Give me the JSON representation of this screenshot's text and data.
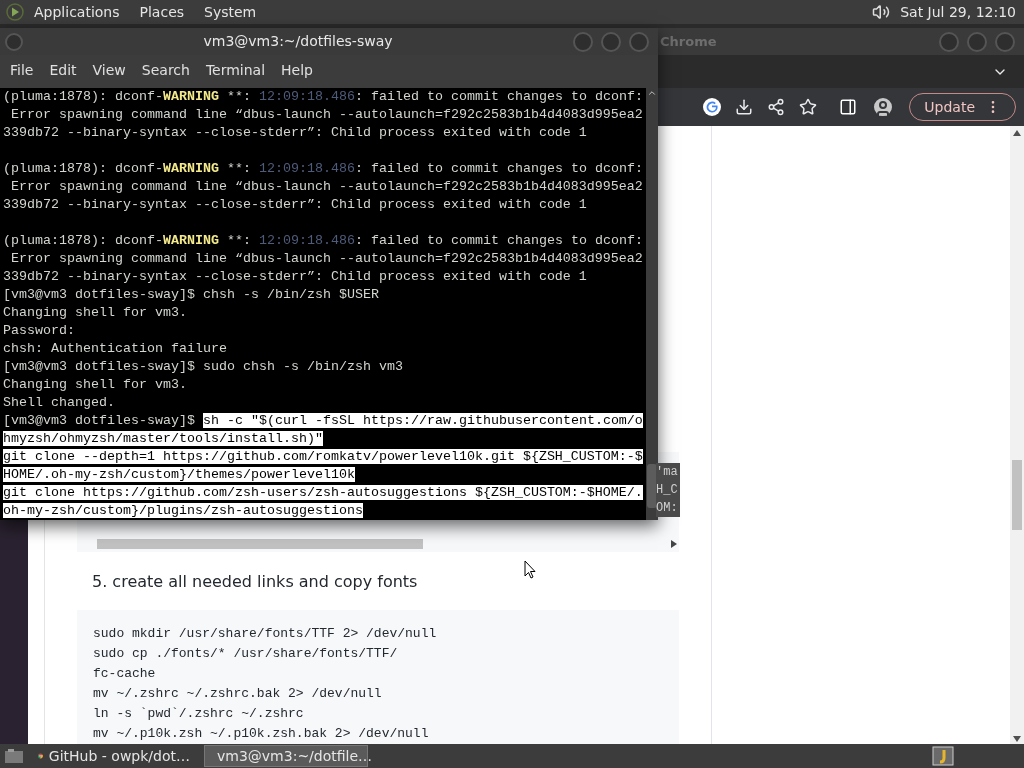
{
  "top_panel": {
    "menus": [
      "Applications",
      "Places",
      "System"
    ],
    "clock": "Sat Jul 29, 12:10"
  },
  "browser": {
    "title": "Chrome",
    "update_button": "Update",
    "page": {
      "heading": "5. create all needed links and copy fonts",
      "code_lines": [
        "sudo mkdir /usr/share/fonts/TTF 2> /dev/null",
        "sudo cp ./fonts/* /usr/share/fonts/TTF/",
        "fc-cache",
        "mv ~/.zshrc ~/.zshrc.bak 2> /dev/null",
        "ln -s `pwd`/.zshrc ~/.zshrc",
        "mv ~/.p10k.zsh ~/.p10k.zsh.bak 2> /dev/null"
      ]
    }
  },
  "terminal": {
    "title": "vm3@vm3:~/dotfiles-sway",
    "menu": [
      "File",
      "Edit",
      "View",
      "Search",
      "Terminal",
      "Help"
    ],
    "lines": [
      {
        "kind": "text",
        "segments": [
          {
            "kind": "plain",
            "text": "(pluma:1878): dconf-"
          },
          {
            "kind": "warning",
            "text": "WARNING"
          },
          {
            "kind": "plain",
            "text": " **: "
          },
          {
            "kind": "timestamp",
            "text": "12:09:18.486"
          },
          {
            "kind": "plain",
            "text": ": failed to commit changes to dconf:"
          }
        ]
      },
      {
        "kind": "text",
        "segments": [
          {
            "kind": "plain",
            "text": " Error spawning command line “dbus-launch --autolaunch=f292c2583b1b4d4083d995ea2"
          }
        ]
      },
      {
        "kind": "text",
        "segments": [
          {
            "kind": "plain",
            "text": "339db72 --binary-syntax --close-stderr”: Child process exited with code 1"
          }
        ]
      },
      {
        "kind": "blank"
      },
      {
        "kind": "text",
        "segments": [
          {
            "kind": "plain",
            "text": "(pluma:1878): dconf-"
          },
          {
            "kind": "warning",
            "text": "WARNING"
          },
          {
            "kind": "plain",
            "text": " **: "
          },
          {
            "kind": "timestamp",
            "text": "12:09:18.486"
          },
          {
            "kind": "plain",
            "text": ": failed to commit changes to dconf:"
          }
        ]
      },
      {
        "kind": "text",
        "segments": [
          {
            "kind": "plain",
            "text": " Error spawning command line “dbus-launch --autolaunch=f292c2583b1b4d4083d995ea2"
          }
        ]
      },
      {
        "kind": "text",
        "segments": [
          {
            "kind": "plain",
            "text": "339db72 --binary-syntax --close-stderr”: Child process exited with code 1"
          }
        ]
      },
      {
        "kind": "blank"
      },
      {
        "kind": "text",
        "segments": [
          {
            "kind": "plain",
            "text": "(pluma:1878): dconf-"
          },
          {
            "kind": "warning",
            "text": "WARNING"
          },
          {
            "kind": "plain",
            "text": " **: "
          },
          {
            "kind": "timestamp",
            "text": "12:09:18.486"
          },
          {
            "kind": "plain",
            "text": ": failed to commit changes to dconf:"
          }
        ]
      },
      {
        "kind": "text",
        "segments": [
          {
            "kind": "plain",
            "text": " Error spawning command line “dbus-launch --autolaunch=f292c2583b1b4d4083d995ea2"
          }
        ]
      },
      {
        "kind": "text",
        "segments": [
          {
            "kind": "plain",
            "text": "339db72 --binary-syntax --close-stderr”: Child process exited with code 1"
          }
        ]
      },
      {
        "kind": "text",
        "segments": [
          {
            "kind": "plain",
            "text": "[vm3@vm3 dotfiles-sway]$ chsh -s /bin/zsh $USER"
          }
        ]
      },
      {
        "kind": "text",
        "segments": [
          {
            "kind": "plain",
            "text": "Changing shell for vm3."
          }
        ]
      },
      {
        "kind": "text",
        "segments": [
          {
            "kind": "plain",
            "text": "Password:"
          }
        ]
      },
      {
        "kind": "text",
        "segments": [
          {
            "kind": "plain",
            "text": "chsh: Authentication failure"
          }
        ]
      },
      {
        "kind": "text",
        "segments": [
          {
            "kind": "plain",
            "text": "[vm3@vm3 dotfiles-sway]$ sudo chsh -s /bin/zsh vm3"
          }
        ]
      },
      {
        "kind": "text",
        "segments": [
          {
            "kind": "plain",
            "text": "Changing shell for vm3."
          }
        ]
      },
      {
        "kind": "text",
        "segments": [
          {
            "kind": "plain",
            "text": "Shell changed."
          }
        ]
      },
      {
        "kind": "text",
        "segments": [
          {
            "kind": "plain",
            "text": "[vm3@vm3 dotfiles-sway]$ "
          },
          {
            "kind": "selected",
            "text": "sh -c \"$(curl -fsSL https://raw.githubusercontent.com/o"
          }
        ]
      },
      {
        "kind": "text",
        "segments": [
          {
            "kind": "selected",
            "text": "hmyzsh/ohmyzsh/master/tools/install.sh)\""
          }
        ]
      },
      {
        "kind": "text",
        "segments": [
          {
            "kind": "selected",
            "text": "git clone --depth=1 https://github.com/romkatv/powerlevel10k.git ${ZSH_CUSTOM:-$"
          }
        ]
      },
      {
        "kind": "text",
        "segments": [
          {
            "kind": "selected",
            "text": "HOME/.oh-my-zsh/custom}/themes/powerlevel10k"
          }
        ]
      },
      {
        "kind": "text",
        "segments": [
          {
            "kind": "selected",
            "text": "git clone https://github.com/zsh-users/zsh-autosuggestions ${ZSH_CUSTOM:-$HOME/."
          }
        ]
      },
      {
        "kind": "text",
        "segments": [
          {
            "kind": "selected",
            "text": "oh-my-zsh/custom}/plugins/zsh-autosuggestions"
          }
        ]
      }
    ]
  },
  "peek_text": [
    "'ma",
    "H_C",
    "OM:"
  ],
  "taskbar": {
    "tasks": [
      {
        "label": "GitHub - owpk/dot…",
        "kind": "browser",
        "selected": false
      },
      {
        "label": "vm3@vm3:~/dotfile…",
        "kind": "terminal",
        "selected": true
      }
    ]
  }
}
